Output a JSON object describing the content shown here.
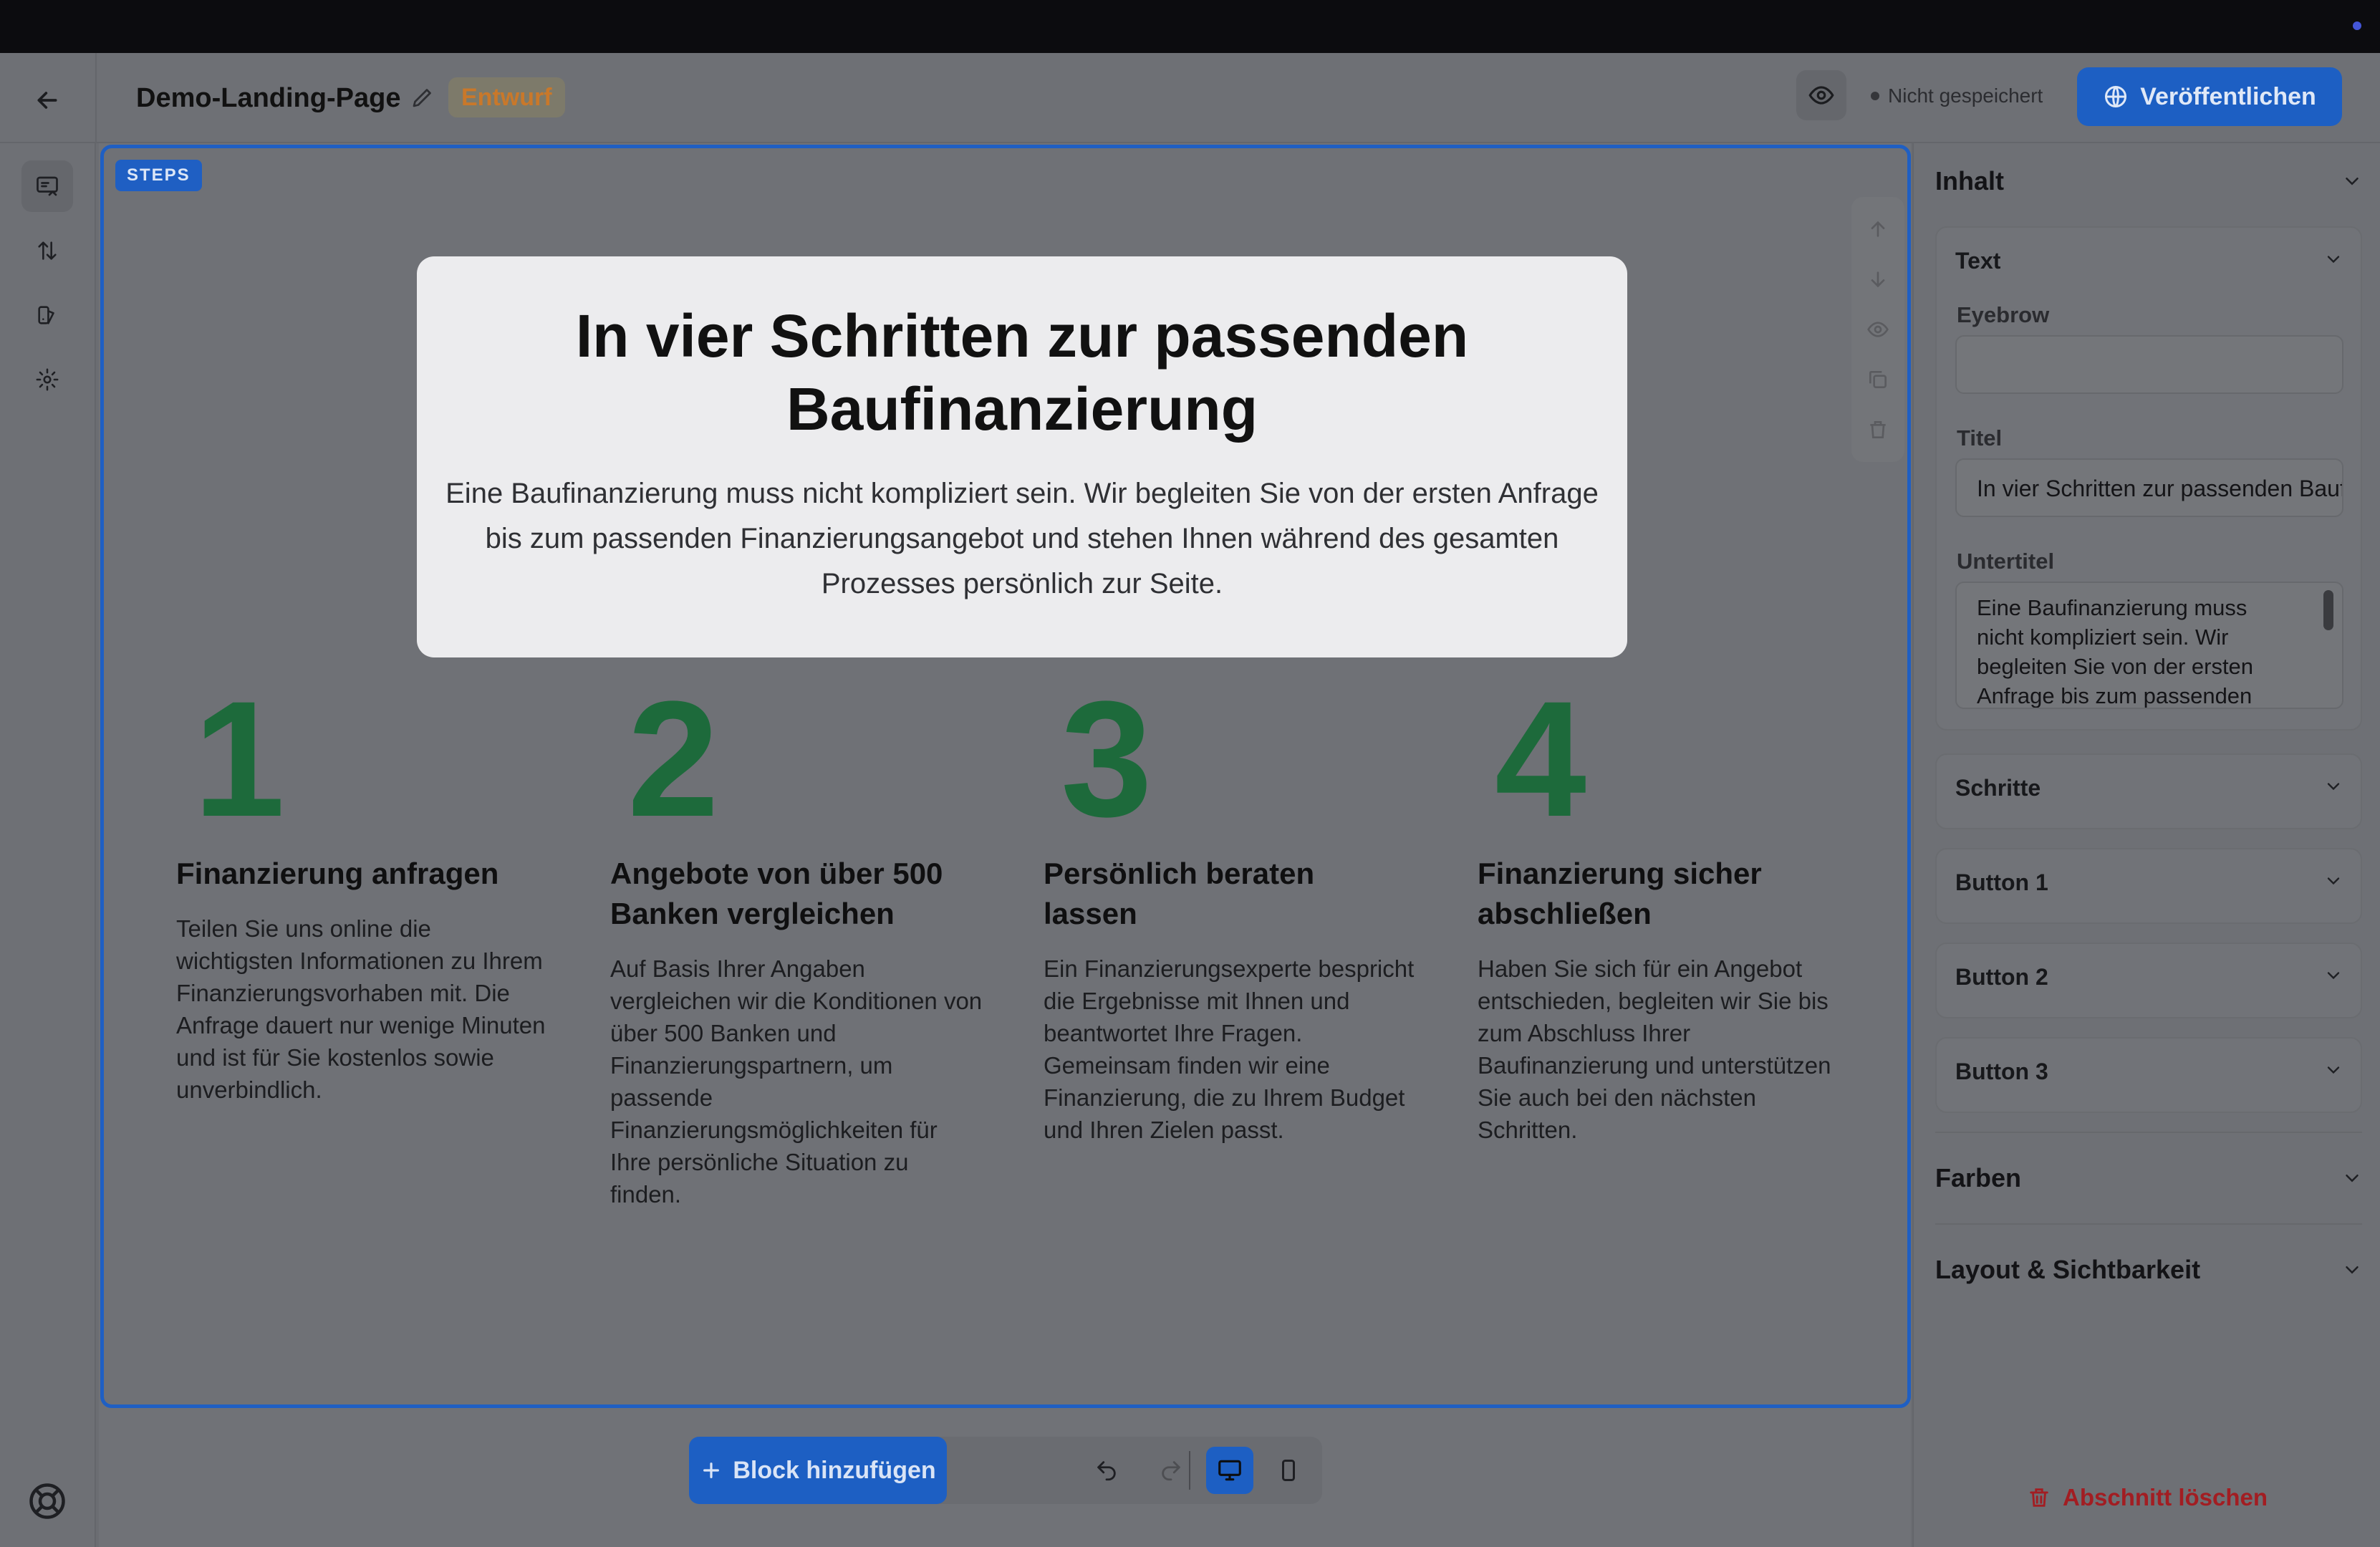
{
  "header": {
    "doc_title": "Demo-Landing-Page",
    "status_badge": "Entwurf",
    "save_status": "Nicht gespeichert",
    "publish_label": "Veröffentlichen"
  },
  "section": {
    "tag": "STEPS",
    "title": "In vier Schritten zur passenden Baufinanzierung",
    "subtitle": "Eine Baufinanzierung muss nicht kompliziert sein. Wir begleiten Sie von der ersten Anfrage bis zum passenden Finanzierungsangebot und stehen Ihnen während des gesamten Prozesses persönlich zur Seite.",
    "steps": [
      {
        "num": "1",
        "title": "Finanzierung anfragen",
        "desc": "Teilen Sie uns online die wichtigsten Informationen zu Ihrem Finanzierungsvorhaben mit. Die Anfrage dauert nur wenige Minuten und ist für Sie kostenlos sowie unverbindlich."
      },
      {
        "num": "2",
        "title": "Angebote von über 500 Banken vergleichen",
        "desc": "Auf Basis Ihrer Angaben vergleichen wir die Konditionen von über 500 Banken und Finanzierungspartnern, um passende Finanzierungsmöglichkeiten für Ihre persönliche Situation zu finden."
      },
      {
        "num": "3",
        "title": "Persönlich beraten lassen",
        "desc": "Ein Finanzierungsexperte bespricht die Ergebnisse mit Ihnen und beantwortet Ihre Fragen. Gemeinsam finden wir eine Finanzierung, die zu Ihrem Budget und Ihren Zielen passt."
      },
      {
        "num": "4",
        "title": "Finanzierung sicher abschließen",
        "desc": "Haben Sie sich für ein Angebot entschieden, begleiten wir Sie bis zum Abschluss Ihrer Baufinanzierung und unterstützen Sie auch bei den nächsten Schritten."
      }
    ]
  },
  "toolbar": {
    "add_block_label": "Block hinzufügen"
  },
  "panel": {
    "content_heading": "Inhalt",
    "text_card": "Text",
    "eyebrow_label": "Eyebrow",
    "eyebrow_value": "",
    "title_label": "Titel",
    "title_value": "In vier Schritten zur passenden Baufinanzierung",
    "subtitle_label": "Untertitel",
    "subtitle_value": "Eine Baufinanzierung muss nicht kompliziert sein. Wir begleiten Sie von der ersten Anfrage bis zum passenden Finanzierungsangebot und stehen Ihnen während des gesamten Prozesses persönlich zur Seite.",
    "cards": [
      "Schritte",
      "Button 1",
      "Button 2",
      "Button 3"
    ],
    "colors_heading": "Farben",
    "layout_heading": "Layout & Sichtbarkeit",
    "delete_label": "Abschnitt löschen"
  },
  "colors": {
    "accent": "#1d5fc3",
    "step_number": "#1d6a3b",
    "draft_badge": "#c9782a",
    "danger": "#a21d22"
  }
}
